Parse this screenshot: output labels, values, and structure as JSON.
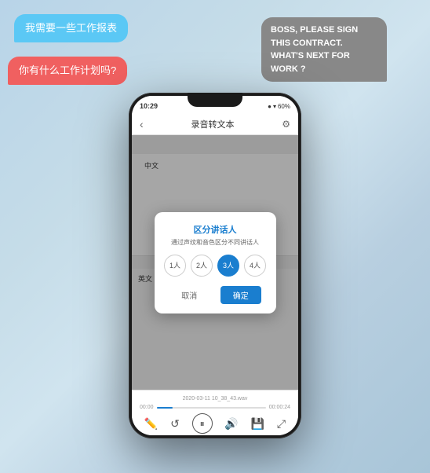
{
  "bubbles": {
    "left1": "我需要一些工作报表",
    "left2": "你有什么工作计划吗?",
    "right1": "BOSS, PLEASE SIGN THIS CONTRACT.",
    "right2": "WHAT'S NEXT FOR WORK ?"
  },
  "phone": {
    "statusBar": {
      "time": "10:29",
      "signal": "▲",
      "wifi": "▾",
      "battery": "60%"
    },
    "navTitle": "录音转文本",
    "langCn": "中文",
    "langEn": "英文",
    "dialog": {
      "title": "区分讲话人",
      "subtitle": "通过声纹和音色区分不同讲话人",
      "options": [
        "1人",
        "2人",
        "3人",
        "4人"
      ],
      "activeIndex": 2,
      "cancelLabel": "取消",
      "confirmLabel": "确定"
    },
    "fileInfo": "2020-03-11 10_38_43.wav",
    "timeLeft": "00:00",
    "timeRight": "00:00:24",
    "progressPercent": 15
  }
}
